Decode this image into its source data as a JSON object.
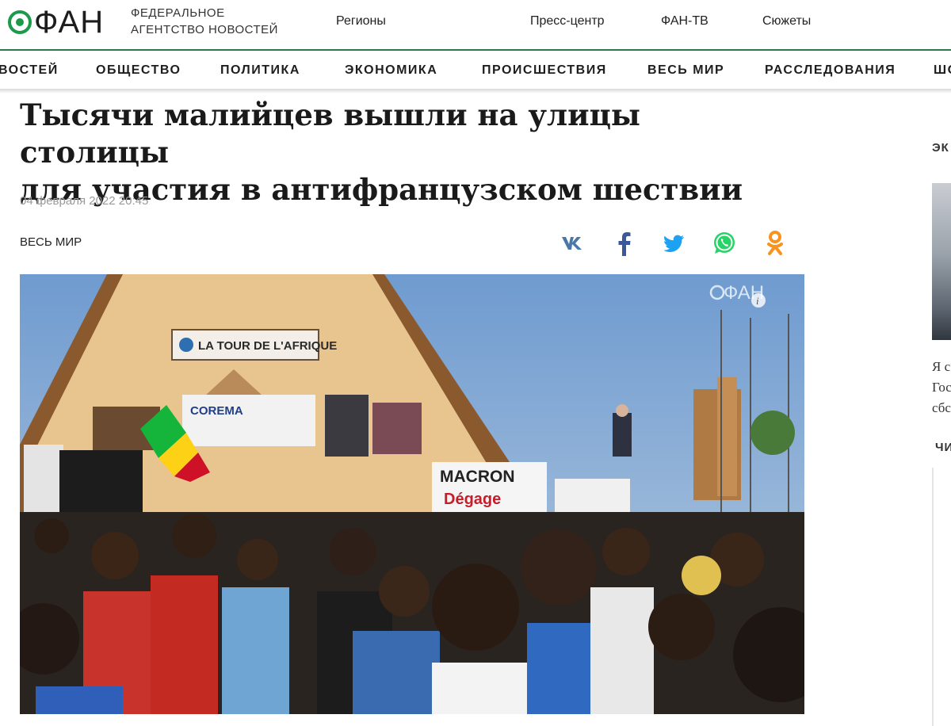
{
  "header": {
    "logo_text": "ФАН",
    "agency_line1": "Федеральное",
    "agency_line2": "агентство новостей",
    "nav": [
      "Регионы",
      "Пресс-центр",
      "ФАН-ТВ",
      "Сюжеты"
    ]
  },
  "categories": [
    "ВОСТЕЙ",
    "ОБЩЕСТВО",
    "ПОЛИТИКА",
    "ЭКОНОМИКА",
    "ПРОИСШЕСТВИЯ",
    "ВЕСЬ МИР",
    "РАССЛЕДОВАНИЯ",
    "ШО"
  ],
  "article": {
    "headline_line1": "Тысячи малийцев вышли на улицы столицы",
    "headline_line2": "для участия в антифранцузском шествии",
    "date": "04 февраля 2022 20:45",
    "section": "ВЕСЬ МИР",
    "share": [
      {
        "name": "vk",
        "color": "#4a76a8"
      },
      {
        "name": "facebook",
        "color": "#3b5998"
      },
      {
        "name": "twitter",
        "color": "#1da1f2"
      },
      {
        "name": "whatsapp",
        "color": "#25d366"
      },
      {
        "name": "odnoklassniki",
        "color": "#f7931e"
      }
    ]
  },
  "photo": {
    "watermark": "ФАН",
    "sign_tower": "LA TOUR DE L'AFRIQUE",
    "banner_corema": "COREMA",
    "banner_macron": "MACRON",
    "banner_degage": "Dégage"
  },
  "sidebar": {
    "heading": "ЭК",
    "text1": "Я с",
    "text2": "Гос",
    "text3": "сбс",
    "heading2": "ЧИ"
  }
}
